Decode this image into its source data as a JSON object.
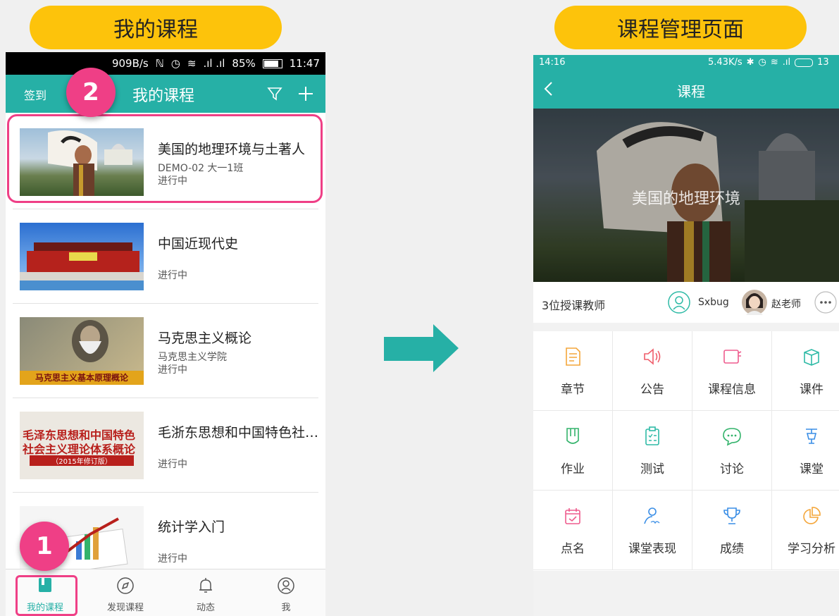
{
  "colors": {
    "accent": "#26b0a6",
    "highlight": "#ef3f86",
    "pill": "#fdc30b"
  },
  "left_panel": {
    "caption": "我的课程",
    "status_bar": {
      "net_speed": "909B/s",
      "battery": "85%",
      "time": "11:47"
    },
    "header": {
      "checkin": "签到",
      "title": "我的课程"
    },
    "courses": [
      {
        "title": "美国的地理环境与土著人",
        "subtitle": "DEMO-02 大一1班",
        "status": "进行中"
      },
      {
        "title": "中国近现代史",
        "subtitle": "",
        "status": "进行中"
      },
      {
        "title": "马克思主义概论",
        "subtitle": "马克思主义学院",
        "status": "进行中",
        "cover_text": "马克思主义基本原理概论"
      },
      {
        "title": "毛浙东思想和中国特色社…",
        "subtitle": "",
        "status": "进行中",
        "cover_line1": "毛泽东思想和中国特色",
        "cover_line2": "社会主义理论体系概论",
        "cover_line3": "（2015年修订版）"
      },
      {
        "title": "统计学入门",
        "subtitle": "",
        "status": "进行中"
      }
    ],
    "tabs": [
      {
        "label": "我的课程",
        "icon": "book-icon",
        "active": true
      },
      {
        "label": "发现课程",
        "icon": "compass-icon"
      },
      {
        "label": "动态",
        "icon": "bell-icon"
      },
      {
        "label": "我",
        "icon": "user-icon"
      }
    ],
    "badges": {
      "one": "1",
      "two": "2"
    }
  },
  "right_panel": {
    "caption": "课程管理页面",
    "status_bar": {
      "time": "14:16",
      "net_speed": "5.43K/s",
      "battery": "13"
    },
    "header": {
      "title": "课程"
    },
    "cover_title": "美国的地理环境",
    "teachers": {
      "label": "3位授课教师",
      "teacher1": "Sxbug",
      "teacher2": "赵老师"
    },
    "grid": [
      {
        "label": "章节",
        "icon": "document-icon",
        "color": "#f4a63a"
      },
      {
        "label": "公告",
        "icon": "speaker-icon",
        "color": "#ef5d6a"
      },
      {
        "label": "课程信息",
        "icon": "course-info-icon",
        "color": "#ee5c8d"
      },
      {
        "label": "课件",
        "icon": "box-icon",
        "color": "#2ebaa6"
      },
      {
        "label": "作业",
        "icon": "homework-icon",
        "color": "#33b36b"
      },
      {
        "label": "测试",
        "icon": "clipboard-icon",
        "color": "#2ebaa6"
      },
      {
        "label": "讨论",
        "icon": "chat-icon",
        "color": "#33b36b"
      },
      {
        "label": "课堂",
        "icon": "lamp-icon",
        "color": "#3a8ee6"
      },
      {
        "label": "点名",
        "icon": "calendar-icon",
        "color": "#ee5c8d"
      },
      {
        "label": "课堂表现",
        "icon": "score-icon",
        "color": "#3a8ee6"
      },
      {
        "label": "成绩",
        "icon": "trophy-icon",
        "color": "#3a8ee6"
      },
      {
        "label": "学习分析",
        "icon": "pie-icon",
        "color": "#f4a63a"
      }
    ]
  }
}
